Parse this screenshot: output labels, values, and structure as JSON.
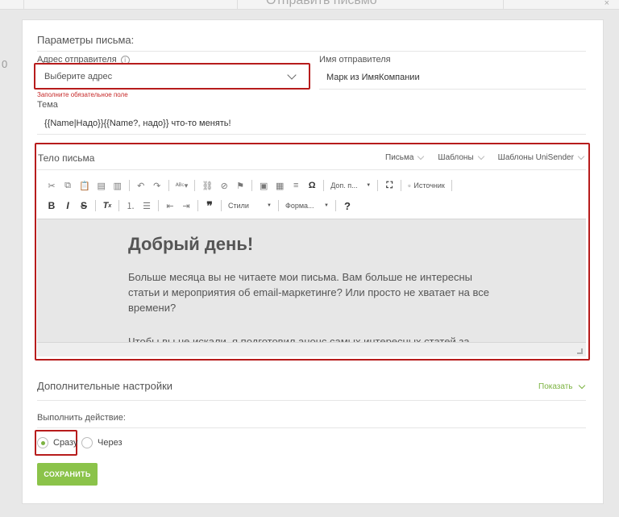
{
  "background": {
    "modal_title": "Отправить письмо",
    "left_digit": "0",
    "close_glyph": "×"
  },
  "section_title": "Параметры письма:",
  "sender_address": {
    "label": "Адрес отправителя",
    "info_icon": "info-icon",
    "placeholder": "Выберите адрес",
    "error": "Заполните обязательное поле"
  },
  "sender_name": {
    "label": "Имя отправителя",
    "value": "Марк из ИмяКомпании"
  },
  "subject": {
    "label": "Тема",
    "value": "{{Name|Надо}}{{Name?, надо}} что-то менять!"
  },
  "body": {
    "label": "Тело письма",
    "menus": [
      "Письма",
      "Шаблоны",
      "Шаблоны UniSender"
    ],
    "toolbar": {
      "extra_dropdown": "Доп. п...",
      "source_label": "Источник",
      "styles_dropdown": "Стили",
      "format_dropdown": "Форма...",
      "help_label": "?"
    },
    "content": {
      "heading": "Добрый день!",
      "paragraph1": "Больше месяца вы не читаете мои письма. Вам больше не интересны статьи и мероприятия об email-маркетинге? Или просто не хватает на все времени?",
      "paragraph2": "Чтобы вы не искали, я подготовил анонс самых интересных статей за"
    }
  },
  "additional": {
    "title": "Дополнительные настройки",
    "toggle_label": "Показать"
  },
  "action": {
    "label": "Выполнить действие:",
    "options": [
      {
        "label": "Сразу",
        "selected": true
      },
      {
        "label": "Через",
        "selected": false
      }
    ]
  },
  "save_label": "СОХРАНИТЬ",
  "colors": {
    "accent_green": "#8bc34a",
    "highlight_red": "#b71c1c",
    "error_red": "#c62828"
  }
}
